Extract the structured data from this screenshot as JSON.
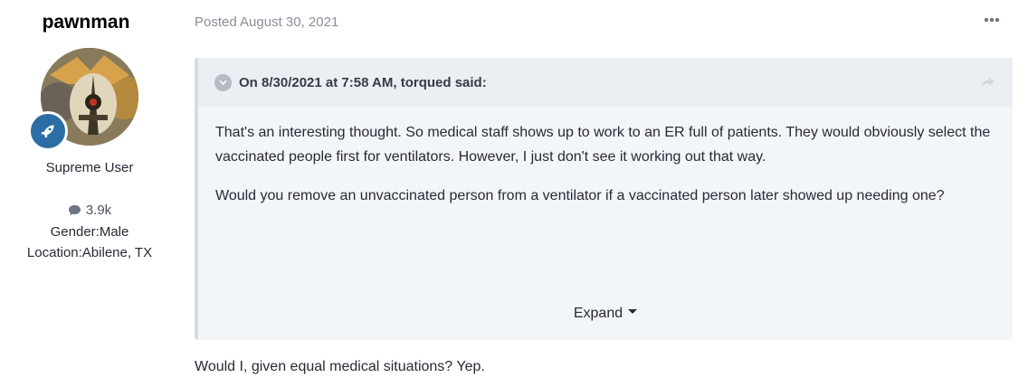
{
  "author": {
    "username": "pawnman",
    "title": "Supreme User",
    "post_count": "3.9k",
    "gender": "Gender:Male",
    "location": "Location:Abilene, TX",
    "avatar_icon": "avatar-image",
    "rank_icon": "rocket-icon",
    "rank_color": "#2b6ea6"
  },
  "post": {
    "meta": "Posted August 30, 2021",
    "quote": {
      "citation": "On 8/30/2021 at 7:58 AM, torqued said:",
      "paragraphs": [
        "That's an interesting thought. So medical staff shows up to work to an ER full of patients. They would obviously select the vaccinated people first for ventilators. However, I just don't see it working out that way.",
        "Would you remove an unvaccinated person from a ventilator if a vaccinated person later showed up needing one?"
      ],
      "expand_label": "Expand"
    },
    "reply_text": "Would I, given equal medical situations? Yep."
  }
}
